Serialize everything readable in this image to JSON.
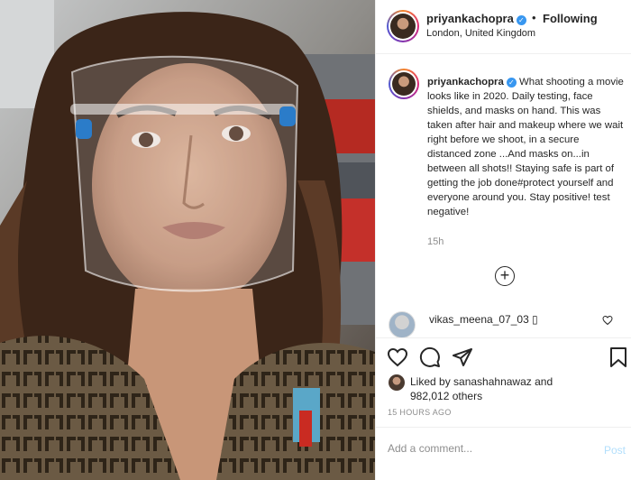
{
  "post": {
    "username": "priyankachopra",
    "follow_separator": "•",
    "follow_label": "Following",
    "location": "London, United Kingdom",
    "caption": "What shooting a movie looks like in 2020. Daily testing, face shields, and masks on hand. This was taken after hair and makeup where we wait right before we shoot, in a secure distanced zone ...And masks on...in between all shots!! Staying safe is part of getting the job done#protect yourself and everyone around you. Stay positive! test negative!",
    "caption_time": "15h",
    "load_more_icon": "plus-circle-icon",
    "comment": {
      "username": "vikas_meena_07_03",
      "text": "▯"
    },
    "likes_prefix": "Liked by ",
    "likes_user": "sanashahnawaz",
    "likes_and": " and",
    "likes_count": "982,012 others",
    "posted_ago": "15 HOURS AGO",
    "comment_placeholder": "Add a comment...",
    "post_label": "Post",
    "verified_icon": "verified-badge-icon",
    "accent_color": "#3897f0"
  }
}
